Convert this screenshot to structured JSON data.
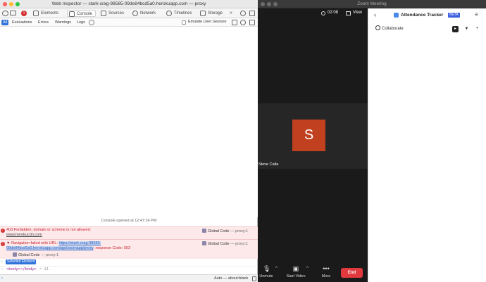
{
  "inspector": {
    "title": "Web Inspector — stark-crag-98585-09de84bcd5a0.herokuapp.com — proxy",
    "badge_count": "1",
    "tabs": [
      {
        "label": "Elements",
        "icon": "elements-icon"
      },
      {
        "label": "Console",
        "icon": "console-icon"
      },
      {
        "label": "Sources",
        "icon": "sources-icon"
      },
      {
        "label": "Network",
        "icon": "network-icon"
      },
      {
        "label": "Timelines",
        "icon": "timelines-icon"
      },
      {
        "label": "Storage",
        "icon": "storage-icon"
      }
    ],
    "filters": [
      "All",
      "Evaluations",
      "Errors",
      "Warnings",
      "Logs"
    ],
    "emulate_label": "Emulate User Gesture",
    "console_opened": "Console opened at 12:47:24 PM",
    "errors": [
      {
        "message": "403 Forbidden, domain or scheme is not allowed:",
        "url": "www.herokucdn.com",
        "source": "Global Code",
        "location": "— proxy:1"
      },
      {
        "message_prefix": "Navigation failed with URL: ",
        "url_line1": "https://stark-crag-98585-",
        "url_line2": "09de84bcd5a0.herokuapp.com/api/zoomapp/proxy",
        "message_suffix": ", response Code: 503",
        "source": "Global Code",
        "location": "— proxy:1",
        "stack_source": "Global Code",
        "stack_location": "— proxy:1"
      }
    ],
    "selected_element_label": "Selected Element",
    "body_line": "<body></body>",
    "body_ref": "= $1",
    "status_context": "Auto — about:blank"
  },
  "zoom": {
    "window_title": "Zoom Meeting",
    "time": "02:08",
    "view_label": "View",
    "participant_initial": "S",
    "participant_name": "Steve Calla",
    "controls": {
      "unmute": "Unmute",
      "start_video": "Start Video",
      "more": "More",
      "end": "End"
    },
    "colors": {
      "avatar": "#c0401f",
      "end": "#e0393e"
    }
  },
  "app": {
    "title": "Attendance Tracker",
    "beta_label": "BETA",
    "collaborate_label": "Collaborate"
  }
}
